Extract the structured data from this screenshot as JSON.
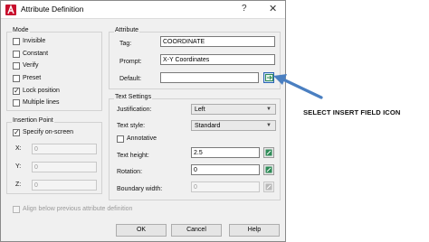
{
  "window": {
    "title": "Attribute Definition",
    "help": "?",
    "close": "✕"
  },
  "mode": {
    "heading": "Mode",
    "items": [
      {
        "label": "Invisible",
        "checked": false
      },
      {
        "label": "Constant",
        "checked": false
      },
      {
        "label": "Verify",
        "checked": false
      },
      {
        "label": "Preset",
        "checked": false
      },
      {
        "label": "Lock position",
        "checked": true
      },
      {
        "label": "Multiple lines",
        "checked": false
      }
    ]
  },
  "insertion": {
    "heading": "Insertion Point",
    "specify_label": "Specify on-screen",
    "specify_checked": true,
    "x_label": "X:",
    "x_value": "0",
    "y_label": "Y:",
    "y_value": "0",
    "z_label": "Z:",
    "z_value": "0"
  },
  "attribute": {
    "heading": "Attribute",
    "tag_label": "Tag:",
    "tag_value": "COORDINATE",
    "prompt_label": "Prompt:",
    "prompt_value": "X-Y Coordinates",
    "default_label": "Default:",
    "default_value": ""
  },
  "text_settings": {
    "heading": "Text Settings",
    "justification_label": "Justification:",
    "justification_value": "Left",
    "style_label": "Text style:",
    "style_value": "Standard",
    "annotative_label": "Annotative",
    "annotative_checked": false,
    "height_label": "Text height:",
    "height_value": "2.5",
    "rotation_label": "Rotation:",
    "rotation_value": "0",
    "boundary_label": "Boundary width:",
    "boundary_value": "0"
  },
  "align_label": "Align below previous attribute definition",
  "buttons": {
    "ok": "OK",
    "cancel": "Cancel",
    "help": "Help"
  },
  "annotation": "SELECT INSERT FIELD ICON",
  "colors": {
    "arrow": "#4a7fc1",
    "field_icon": "#2e8b57",
    "accent": "#2a64b4"
  }
}
